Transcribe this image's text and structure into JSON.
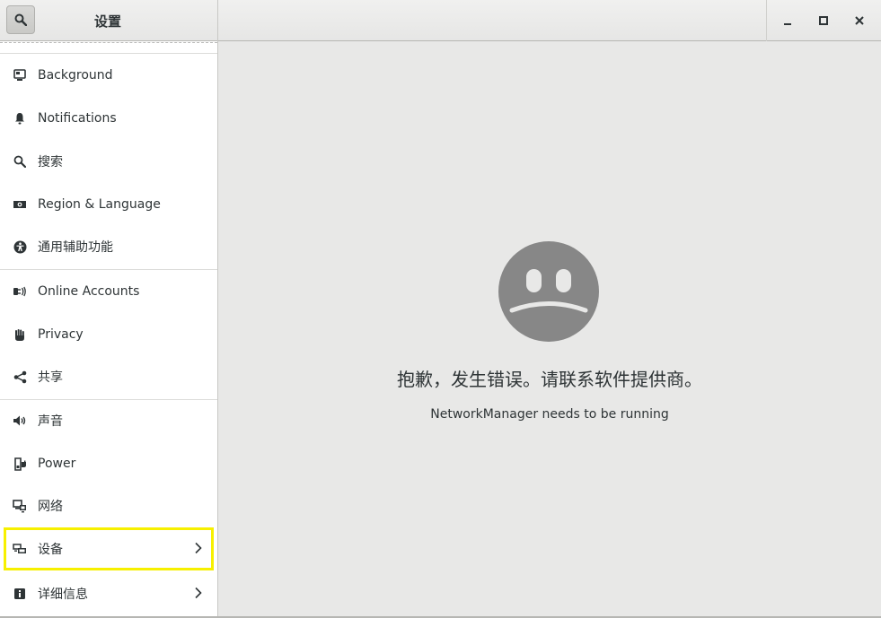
{
  "window": {
    "title": "设置"
  },
  "sidebar": {
    "items": [
      {
        "label": "Background",
        "icon": "background-icon"
      },
      {
        "label": "Notifications",
        "icon": "bell-icon"
      },
      {
        "label": "搜索",
        "icon": "search-icon"
      },
      {
        "label": "Region & Language",
        "icon": "region-flag-icon"
      },
      {
        "label": "通用辅助功能",
        "icon": "accessibility-icon"
      },
      {
        "label": "Online Accounts",
        "icon": "online-accounts-icon"
      },
      {
        "label": "Privacy",
        "icon": "hand-icon"
      },
      {
        "label": "共享",
        "icon": "share-icon"
      },
      {
        "label": "声音",
        "icon": "speaker-icon"
      },
      {
        "label": "Power",
        "icon": "power-plug-icon"
      },
      {
        "label": "网络",
        "icon": "network-icon"
      },
      {
        "label": "设备",
        "icon": "devices-icon",
        "has_submenu": true,
        "highlighted": true
      },
      {
        "label": "详细信息",
        "icon": "info-icon",
        "has_submenu": true
      }
    ]
  },
  "main": {
    "error_icon": "sad-face-icon",
    "error_title": "抱歉，发生错误。请联系软件提供商。",
    "error_detail": "NetworkManager needs to be running"
  },
  "colors": {
    "highlight": "#f7f000",
    "face": "#878787",
    "background": "#e8e8e7"
  }
}
